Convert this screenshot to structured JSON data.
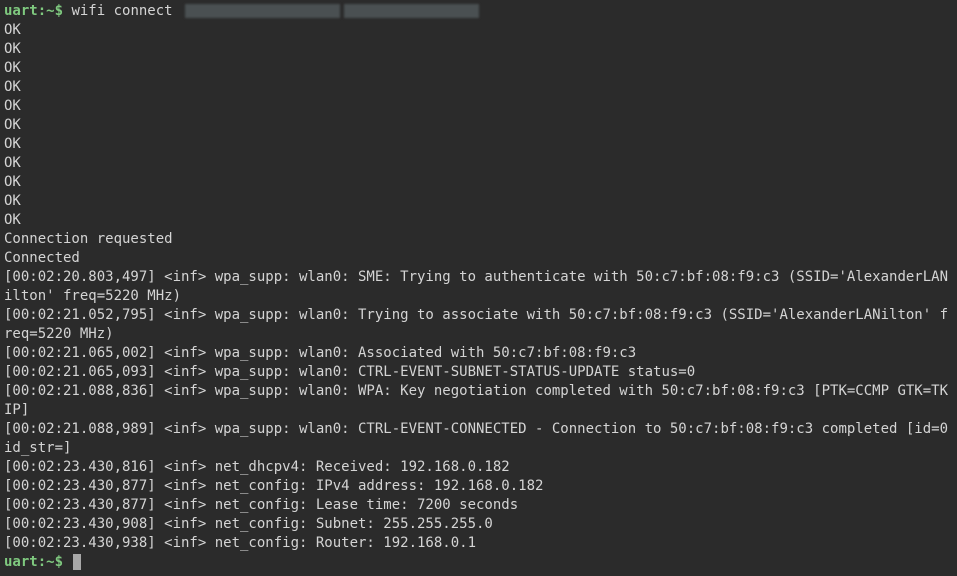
{
  "prompt1": {
    "host": "uart:~$",
    "command": "wifi connect"
  },
  "ok_lines": [
    "OK",
    "OK",
    "OK",
    "OK",
    "OK",
    "OK",
    "OK",
    "OK",
    "OK",
    "OK",
    "OK"
  ],
  "status1": "Connection requested",
  "status2": "Connected",
  "log": [
    "[00:02:20.803,497] <inf> wpa_supp: wlan0: SME: Trying to authenticate with 50:c7:bf:08:f9:c3 (SSID='AlexanderLANilton' freq=5220 MHz)",
    "[00:02:21.052,795] <inf> wpa_supp: wlan0: Trying to associate with 50:c7:bf:08:f9:c3 (SSID='AlexanderLANilton' freq=5220 MHz)",
    "[00:02:21.065,002] <inf> wpa_supp: wlan0: Associated with 50:c7:bf:08:f9:c3",
    "[00:02:21.065,093] <inf> wpa_supp: wlan0: CTRL-EVENT-SUBNET-STATUS-UPDATE status=0",
    "[00:02:21.088,836] <inf> wpa_supp: wlan0: WPA: Key negotiation completed with 50:c7:bf:08:f9:c3 [PTK=CCMP GTK=TKIP]",
    "[00:02:21.088,989] <inf> wpa_supp: wlan0: CTRL-EVENT-CONNECTED - Connection to 50:c7:bf:08:f9:c3 completed [id=0 id_str=]",
    "[00:02:23.430,816] <inf> net_dhcpv4: Received: 192.168.0.182",
    "[00:02:23.430,877] <inf> net_config: IPv4 address: 192.168.0.182",
    "[00:02:23.430,877] <inf> net_config: Lease time: 7200 seconds",
    "[00:02:23.430,908] <inf> net_config: Subnet: 255.255.255.0",
    "[00:02:23.430,938] <inf> net_config: Router: 192.168.0.1"
  ],
  "prompt2": {
    "host": "uart:~$"
  }
}
